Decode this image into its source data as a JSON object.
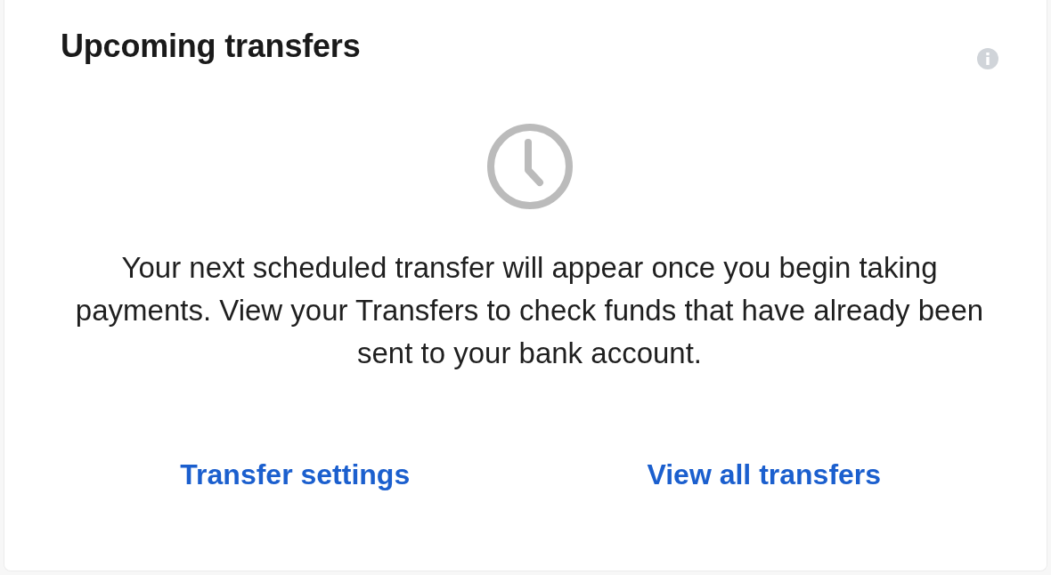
{
  "card": {
    "title": "Upcoming transfers",
    "message": "Your next scheduled transfer will appear once you begin taking payments. View your Transfers to check funds that have already been sent to your bank account.",
    "links": [
      {
        "label": "Transfer settings"
      },
      {
        "label": "View all transfers"
      }
    ]
  }
}
